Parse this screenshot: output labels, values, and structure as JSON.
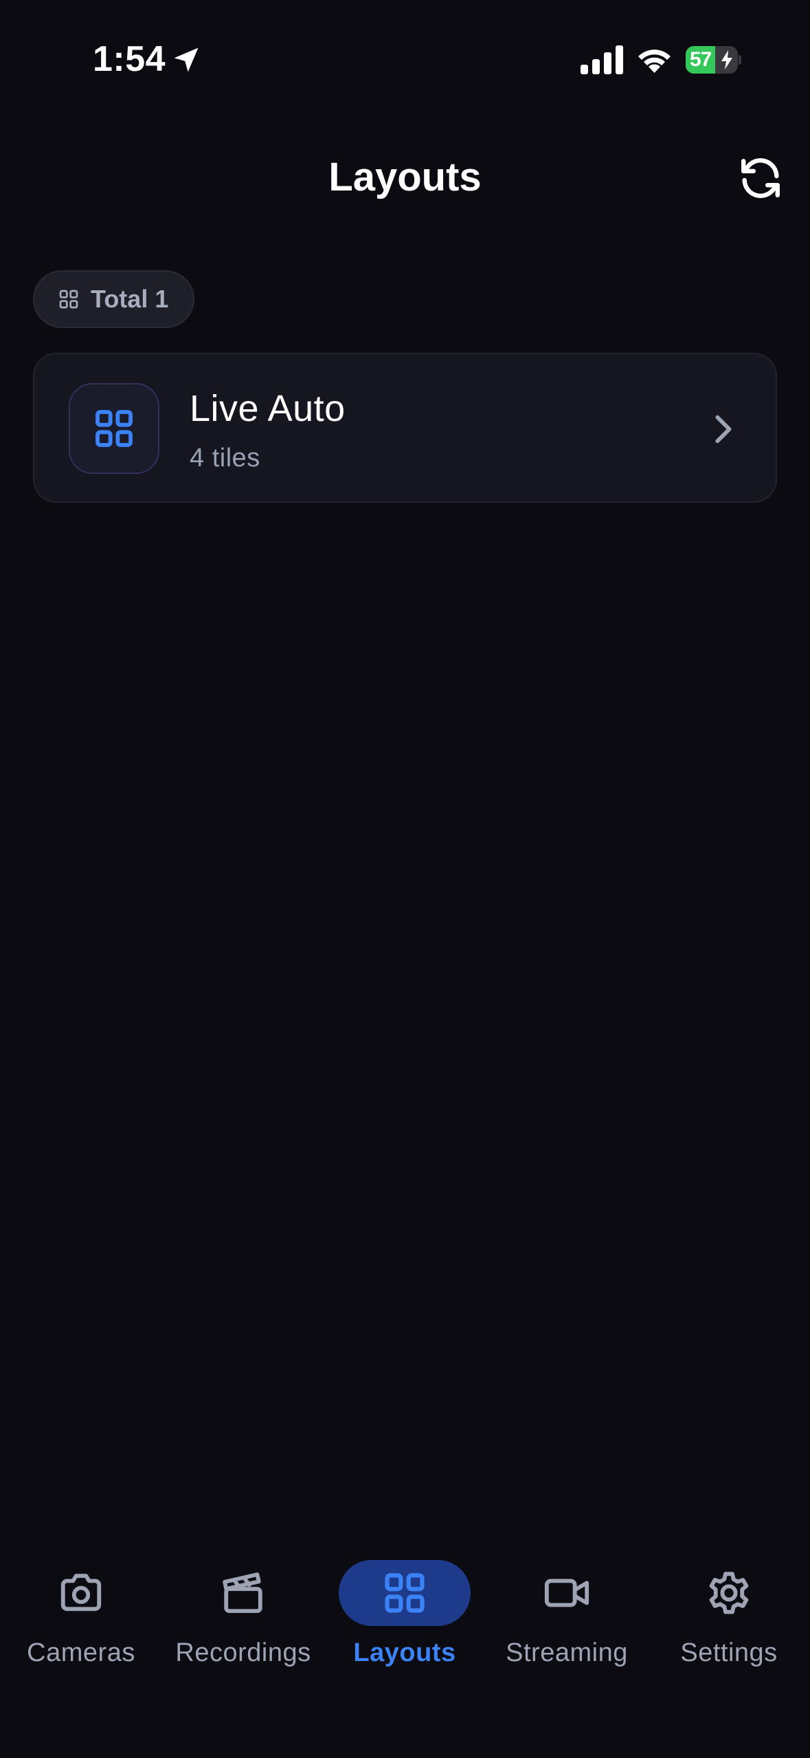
{
  "status_bar": {
    "time": "1:54",
    "battery_level": "57",
    "battery_fraction": 0.57,
    "icons": [
      "location-arrow-icon",
      "cellular-signal-icon",
      "wifi-icon",
      "battery-charging-icon"
    ]
  },
  "header": {
    "title": "Layouts",
    "refresh_icon": "refresh-icon"
  },
  "summary": {
    "total_label": "Total 1",
    "icon": "grid-icon"
  },
  "layouts": [
    {
      "name": "Live Auto",
      "subtitle": "4 tiles",
      "icon": "grid-icon"
    }
  ],
  "tab_bar": {
    "active": "Layouts",
    "tabs": [
      {
        "label": "Cameras",
        "icon": "camera-icon"
      },
      {
        "label": "Recordings",
        "icon": "clapperboard-icon"
      },
      {
        "label": "Layouts",
        "icon": "grid-icon"
      },
      {
        "label": "Streaming",
        "icon": "video-camera-icon"
      },
      {
        "label": "Settings",
        "icon": "gear-icon"
      }
    ]
  },
  "colors": {
    "background": "#0b0b11",
    "accent": "#3b82f6",
    "active_tab_bg": "#1e3a8a",
    "battery_green": "#34c759",
    "muted_text": "#9ea4b4"
  }
}
